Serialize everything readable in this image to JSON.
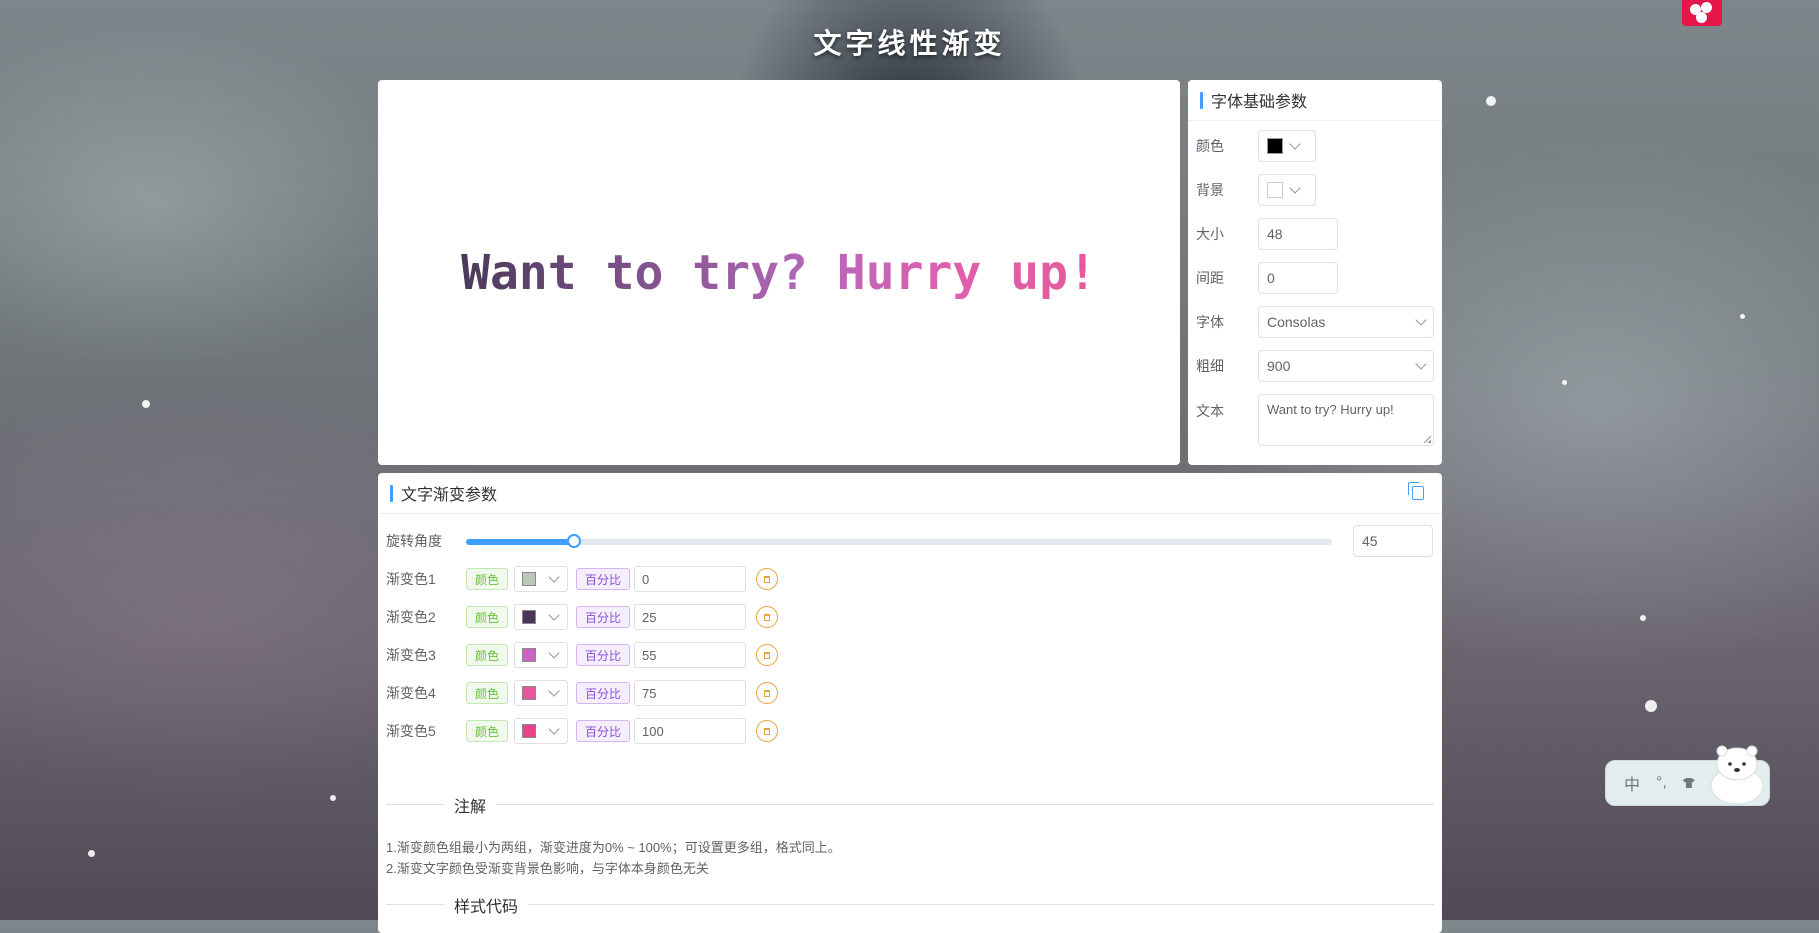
{
  "page": {
    "title": "文字线性渐变"
  },
  "preview": {
    "text": "Want to try? Hurry up!"
  },
  "basic": {
    "title": "字体基础参数",
    "color_label": "颜色",
    "color_value": "#000000",
    "background_label": "背景",
    "background_value": "#ffffff",
    "size_label": "大小",
    "size_value": "48",
    "spacing_label": "间距",
    "spacing_value": "0",
    "font_label": "字体",
    "font_value": "Consolas",
    "weight_label": "粗细",
    "weight_value": "900",
    "text_label": "文本",
    "text_value": "Want to try? Hurry up!"
  },
  "gradient": {
    "title": "文字渐变参数",
    "angle_label": "旋转角度",
    "angle_value": "45",
    "angle_max": 360,
    "color_tag": "颜色",
    "percent_tag": "百分比",
    "stops": [
      {
        "label": "渐变色1",
        "color": "#b9c9b5",
        "percent": "0"
      },
      {
        "label": "渐变色2",
        "color": "#4a3559",
        "percent": "25"
      },
      {
        "label": "渐变色3",
        "color": "#cf62c6",
        "percent": "55"
      },
      {
        "label": "渐变色4",
        "color": "#e6569b",
        "percent": "75"
      },
      {
        "label": "渐变色5",
        "color": "#e6448a",
        "percent": "100"
      }
    ],
    "notes_title": "注解",
    "note1": "1.渐变颜色组最小为两组，渐变进度为0% ~ 100%；可设置更多组，格式同上。",
    "note2": "2.渐变文字颜色受渐变背景色影响，与字体本身颜色无关",
    "code_title": "样式代码"
  },
  "ime": {
    "lang": "中",
    "punct": "°,",
    "skin_icon": "shirt-icon"
  },
  "colors": {
    "accent": "#409eff",
    "logo": "#e6164a"
  }
}
